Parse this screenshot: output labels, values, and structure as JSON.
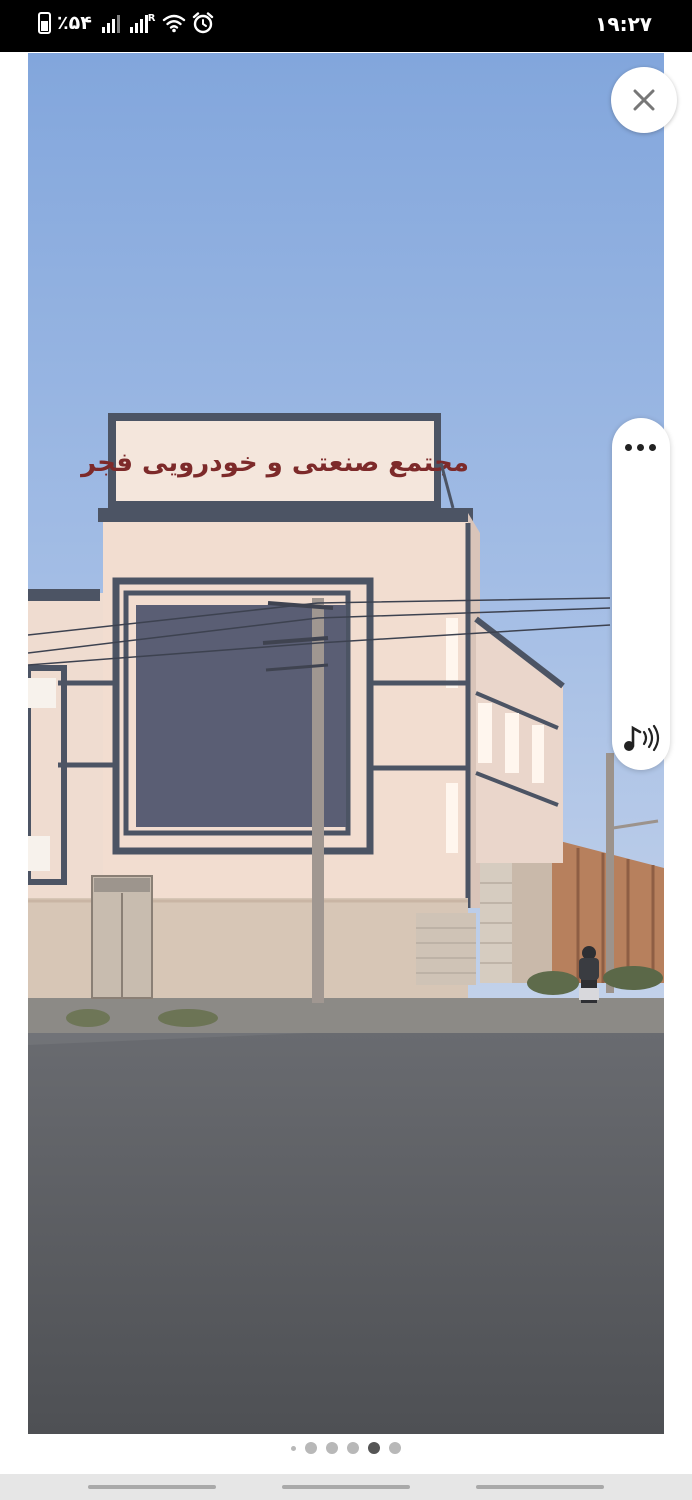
{
  "status_bar": {
    "battery_text": "٪۵۴",
    "signal_roaming": "R",
    "time": "۱۹:۲۷"
  },
  "image": {
    "sign_text": "مجتمع صنعتی و خودرویی فجر"
  },
  "gallery": {
    "page_count": 6,
    "active_page": 4
  },
  "icons": {
    "close": "close-icon",
    "more": "more-options-icon",
    "sound": "sound-icon",
    "wifi": "wifi-icon",
    "alarm": "alarm-icon"
  }
}
